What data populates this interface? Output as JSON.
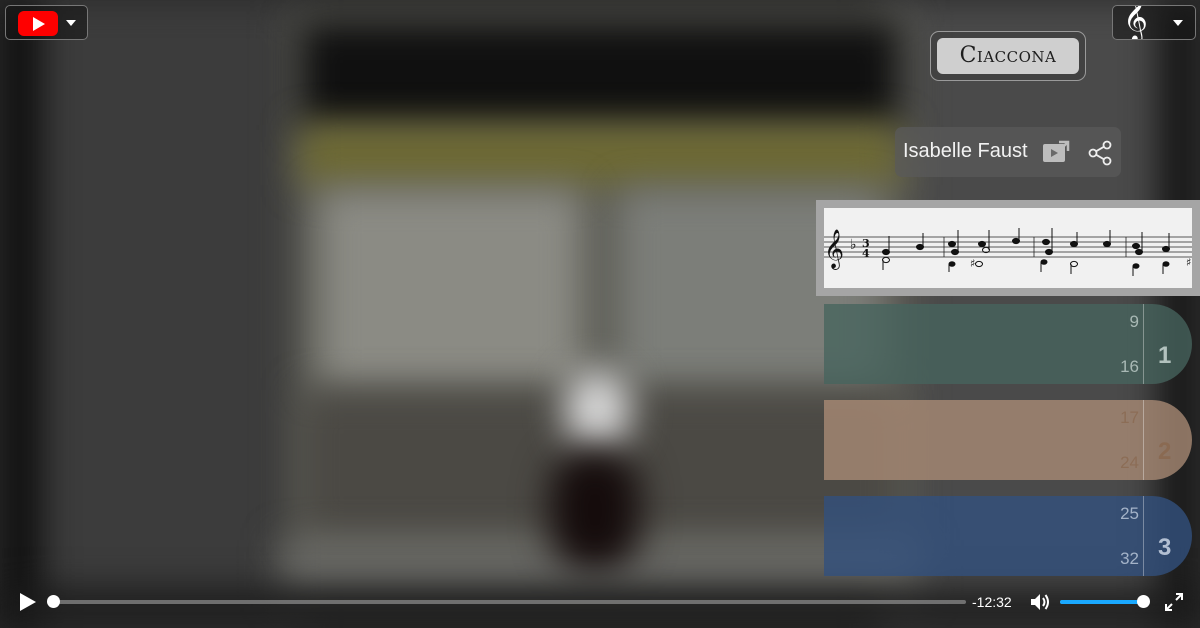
{
  "title": "Ciaccona",
  "performer": {
    "name": "Isabelle Faust",
    "video_link_icon": "video-external-link-icon",
    "share_icon": "share-icon"
  },
  "youtube_button": {
    "icon": "youtube-logo-icon",
    "menu_icon": "chevron-down-icon"
  },
  "clef_button": {
    "icon": "treble-clef-icon",
    "menu_icon": "chevron-down-icon"
  },
  "score": {
    "clef": "treble",
    "key_signature": "♭",
    "time_signature": "3/4"
  },
  "sections": [
    {
      "number": "1",
      "bar_start": "9",
      "bar_end": "16",
      "color": "#46645e"
    },
    {
      "number": "2",
      "bar_start": "17",
      "bar_end": "24",
      "color": "#aa8c76"
    },
    {
      "number": "3",
      "bar_start": "25",
      "bar_end": "32",
      "color": "#32507d"
    }
  ],
  "player": {
    "time_remaining": "-12:32",
    "progress": 0,
    "volume": 1.0,
    "accent_color": "#1aa9ff"
  }
}
